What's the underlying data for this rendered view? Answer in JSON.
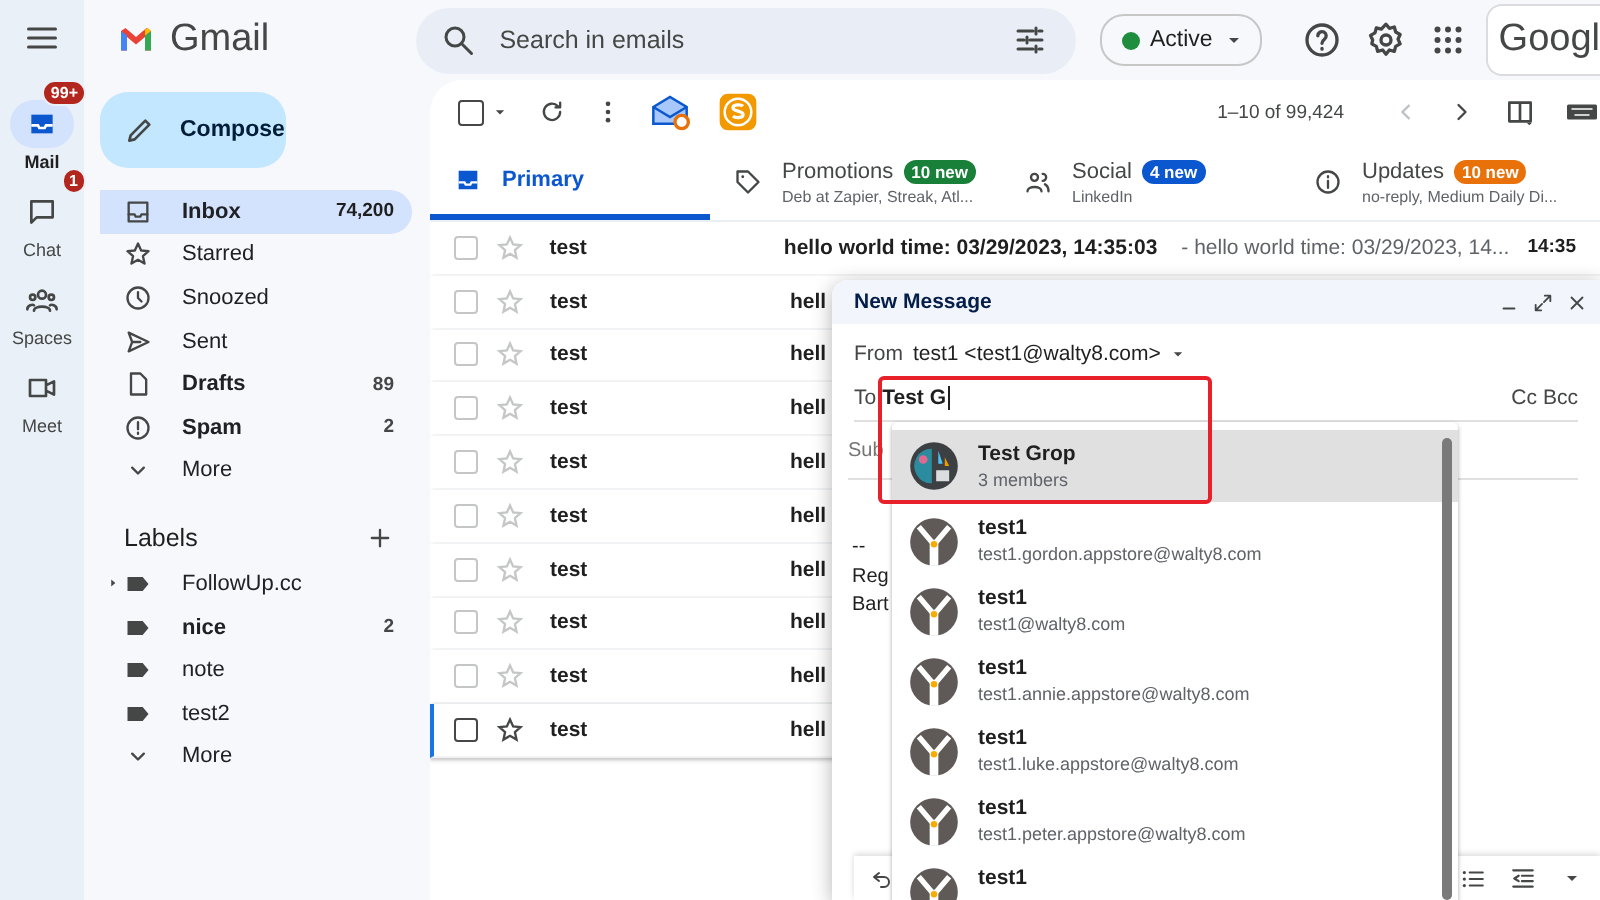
{
  "rail": {
    "items": [
      {
        "label": "Mail",
        "kind": "mail",
        "badge": "99+",
        "selected": true
      },
      {
        "label": "Chat",
        "kind": "chat",
        "badge": "1",
        "selected": false
      },
      {
        "label": "Spaces",
        "kind": "spaces",
        "selected": false
      },
      {
        "label": "Meet",
        "kind": "meet",
        "selected": false
      }
    ]
  },
  "topbar": {
    "app_name": "Gmail",
    "search": {
      "placeholder": "Search in emails"
    },
    "status": {
      "label": "Active",
      "color": "#1e8e3e"
    },
    "account_logo": "Googl"
  },
  "sidebar": {
    "compose": "Compose",
    "items": [
      {
        "label": "Inbox",
        "kind": "inbox",
        "count": "74,200",
        "unread": true,
        "selected": true
      },
      {
        "label": "Starred",
        "kind": "star",
        "unread": false,
        "selected": false
      },
      {
        "label": "Snoozed",
        "kind": "clock",
        "unread": false,
        "selected": false
      },
      {
        "label": "Sent",
        "kind": "send",
        "unread": false,
        "selected": false
      },
      {
        "label": "Drafts",
        "kind": "draft",
        "count": "89",
        "unread": true,
        "selected": false
      },
      {
        "label": "Spam",
        "kind": "spam",
        "count": "2",
        "unread": true,
        "selected": false
      },
      {
        "label": "More",
        "kind": "more",
        "unread": false,
        "selected": false
      }
    ],
    "labels_title": "Labels",
    "labels": [
      {
        "label": "FollowUp.cc",
        "kind": "label",
        "has_children": true,
        "unread": false
      },
      {
        "label": "nice",
        "kind": "label",
        "count": "2",
        "has_children": false,
        "unread": true
      },
      {
        "label": "note",
        "kind": "label",
        "has_children": false,
        "unread": false
      },
      {
        "label": "test2",
        "kind": "label",
        "has_children": false,
        "unread": false
      },
      {
        "label": "More",
        "kind": "more",
        "has_children": false,
        "unread": false
      }
    ]
  },
  "toolbar": {
    "select_all": false,
    "range": "1–10 of 99,424"
  },
  "tabs": [
    {
      "label": "Primary",
      "kind": "inbox",
      "selected": true
    },
    {
      "label": "Promotions",
      "kind": "tag",
      "badge": "10 new",
      "color": "#188038",
      "subtitle": "Deb at Zapier, Streak, Atl...",
      "selected": false
    },
    {
      "label": "Social",
      "kind": "people",
      "badge": "4 new",
      "color": "#0b57d0",
      "subtitle": "LinkedIn",
      "selected": false
    },
    {
      "label": "Updates",
      "kind": "info",
      "badge": "10 new",
      "color": "#e8710a",
      "subtitle": "no-reply, Medium Daily Di...",
      "selected": false
    }
  ],
  "emails": [
    {
      "sender": "test",
      "subject": "hello world time: 03/29/2023, 14:35:03",
      "snippet": "- hello world time: 03/29/2023, 14...",
      "time": "14:35",
      "focused": false
    },
    {
      "sender": "test",
      "subject": "hell",
      "focused": false
    },
    {
      "sender": "test",
      "subject": "hell",
      "focused": false
    },
    {
      "sender": "test",
      "subject": "hell",
      "focused": false
    },
    {
      "sender": "test",
      "subject": "hell",
      "focused": false
    },
    {
      "sender": "test",
      "subject": "hell",
      "focused": false
    },
    {
      "sender": "test",
      "subject": "hell",
      "focused": false
    },
    {
      "sender": "test",
      "subject": "hell",
      "focused": false
    },
    {
      "sender": "test",
      "subject": "hell",
      "focused": false
    },
    {
      "sender": "test",
      "subject": "hell",
      "focused": true
    }
  ],
  "compose": {
    "title": "New Message",
    "from_label": "From",
    "from": "test1 <test1@walty8.com>",
    "to_label": "To",
    "to": "Test G",
    "to_highlighted": true,
    "cc": "Cc",
    "bcc": "Bcc",
    "subject": "Sub",
    "body": [
      "--",
      "Reg",
      "Bart"
    ],
    "suggestions": [
      {
        "kind": "group",
        "name": "Test Grop",
        "detail": "3 members",
        "selected": true
      },
      {
        "kind": "contact",
        "name": "test1",
        "detail": "test1.gordon.appstore@walty8.com",
        "selected": false
      },
      {
        "kind": "contact",
        "name": "test1",
        "detail": "test1@walty8.com",
        "selected": false
      },
      {
        "kind": "contact",
        "name": "test1",
        "detail": "test1.annie.appstore@walty8.com",
        "selected": false
      },
      {
        "kind": "contact",
        "name": "test1",
        "detail": "test1.luke.appstore@walty8.com",
        "selected": false
      },
      {
        "kind": "contact",
        "name": "test1",
        "detail": "test1.peter.appstore@walty8.com",
        "selected": false
      },
      {
        "kind": "contact",
        "name": "test1",
        "selected": false
      }
    ]
  }
}
